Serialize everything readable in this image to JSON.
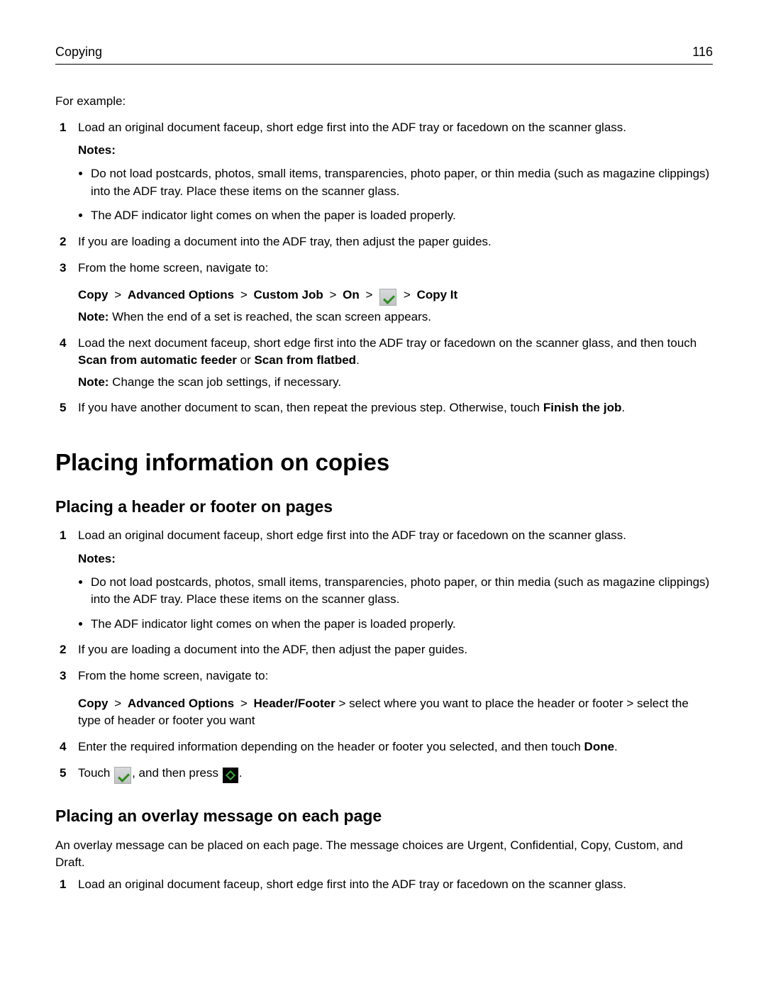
{
  "header": {
    "section": "Copying",
    "page_number": "116"
  },
  "intro": "For example:",
  "sectionA": {
    "step1": {
      "num": "1",
      "text": "Load an original document faceup, short edge first into the ADF tray or facedown on the scanner glass.",
      "notes_label": "Notes:",
      "bullets": [
        "Do not load postcards, photos, small items, transparencies, photo paper, or thin media (such as magazine clippings) into the ADF tray. Place these items on the scanner glass.",
        "The ADF indicator light comes on when the paper is loaded properly."
      ]
    },
    "step2": {
      "num": "2",
      "text": "If you are loading a document into the ADF tray, then adjust the paper guides."
    },
    "step3": {
      "num": "3",
      "text": "From the home screen, navigate to:",
      "crumb": {
        "c1": "Copy",
        "c2": "Advanced Options",
        "c3": "Custom Job",
        "c4": "On",
        "c5": "Copy It",
        "sep": ">"
      },
      "note_prefix": "Note:",
      "note_body": " When the end of a set is reached, the scan screen appears."
    },
    "step4": {
      "num": "4",
      "text_a": "Load the next document faceup, short edge first into the ADF tray or facedown on the scanner glass, and then touch ",
      "bold_a": "Scan from automatic feeder",
      "text_b": " or ",
      "bold_b": "Scan from flatbed",
      "text_c": ".",
      "note_prefix": "Note:",
      "note_body": " Change the scan job settings, if necessary."
    },
    "step5": {
      "num": "5",
      "text_a": "If you have another document to scan, then repeat the previous step. Otherwise, touch ",
      "bold_a": "Finish the job",
      "text_b": "."
    }
  },
  "sectionB": {
    "title": "Placing information on copies",
    "sub1": {
      "title": "Placing a header or footer on pages",
      "step1": {
        "num": "1",
        "text": "Load an original document faceup, short edge first into the ADF tray or facedown on the scanner glass.",
        "notes_label": "Notes:",
        "bullets": [
          "Do not load postcards, photos, small items, transparencies, photo paper, or thin media (such as magazine clippings) into the ADF tray. Place these items on the scanner glass.",
          "The ADF indicator light comes on when the paper is loaded properly."
        ]
      },
      "step2": {
        "num": "2",
        "text": "If you are loading a document into the ADF, then adjust the paper guides."
      },
      "step3": {
        "num": "3",
        "text": "From the home screen, navigate to:",
        "crumb": {
          "c1": "Copy",
          "c2": "Advanced Options",
          "c3": "Header/Footer",
          "sep": ">"
        },
        "tail": " > select where you want to place the header or footer > select the type of header or footer you want"
      },
      "step4": {
        "num": "4",
        "text_a": "Enter the required information depending on the header or footer you selected, and then touch ",
        "bold_a": "Done",
        "text_b": "."
      },
      "step5": {
        "num": "5",
        "text_a": "Touch ",
        "text_b": ", and then press ",
        "text_c": "."
      }
    },
    "sub2": {
      "title": "Placing an overlay message on each page",
      "intro": "An overlay message can be placed on each page. The message choices are Urgent, Confidential, Copy, Custom, and Draft.",
      "step1": {
        "num": "1",
        "text": "Load an original document faceup, short edge first into the ADF tray or facedown on the scanner glass."
      }
    }
  }
}
